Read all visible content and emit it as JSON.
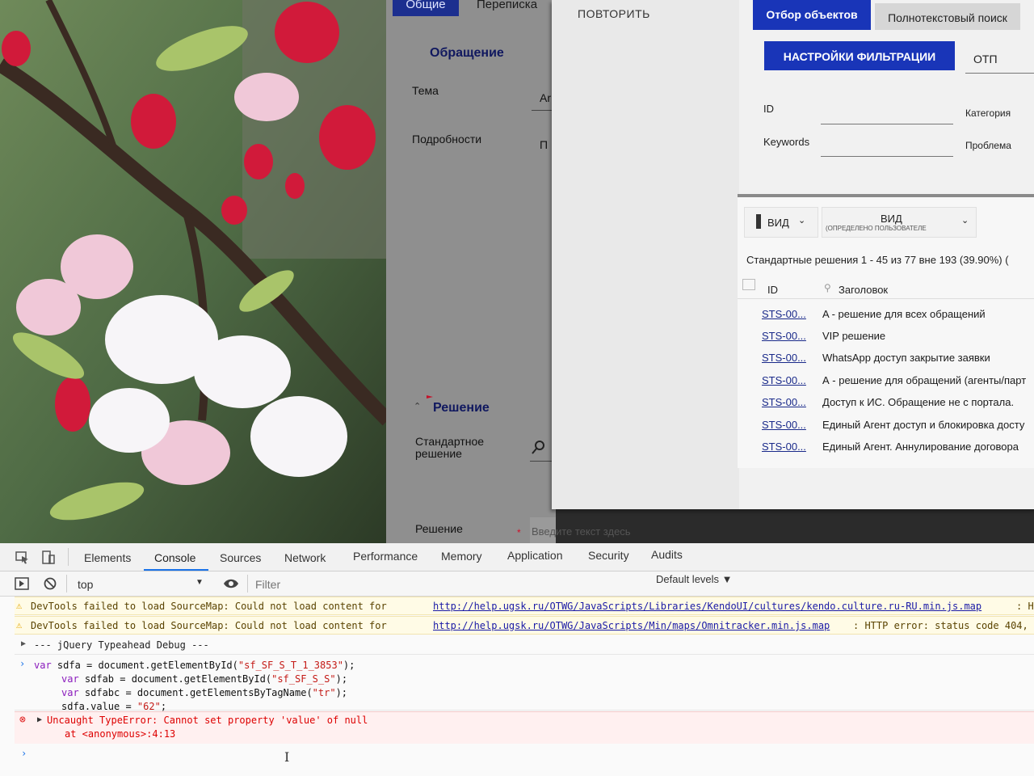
{
  "form": {
    "tab_general": "Общие",
    "tab_correspondence": "Переписка",
    "section_request": "Обращение",
    "label_subject": "Тема",
    "value_subject_cut": "Ar",
    "label_details": "Подробности",
    "value_details_cut": "П",
    "section_solution": "Решение",
    "label_standard_solution": "Стандартное решение",
    "label_solution": "Решение",
    "solution_placeholder": "Введите текст здесь"
  },
  "modal": {
    "repeat_label": "ПОВТОРИТЬ",
    "tab_filter": "Отбор объектов",
    "tab_fulltext": "Полнотекстовый поиск",
    "filter_settings_button": "НАСТРОЙКИ ФИЛЬТРАЦИИ",
    "otp_label": "ОТП",
    "label_id": "ID",
    "label_keywords": "Keywords",
    "label_category": "Категория",
    "label_problem": "Проблема",
    "view_label": "ВИД",
    "view2_label": "ВИД",
    "view2_sub": "(ОПРЕДЕЛЕНО ПОЛЬЗОВАТЕЛЕ",
    "results_summary": "Стандартные решения 1 - 45 из 77 вне 193 (39.90%) (",
    "col_id": "ID",
    "col_title": "Заголовок",
    "rows": [
      {
        "id": "STS-00...",
        "title": "A - решение для всех обращений"
      },
      {
        "id": "STS-00...",
        "title": "VIP решение"
      },
      {
        "id": "STS-00...",
        "title": "WhatsApp доступ закрытие заявки"
      },
      {
        "id": "STS-00...",
        "title": "А - решение для обращений (агенты/парт"
      },
      {
        "id": "STS-00...",
        "title": "Доступ к ИС. Обращение не с портала."
      },
      {
        "id": "STS-00...",
        "title": "Единый Агент доступ и блокировка досту"
      },
      {
        "id": "STS-00...",
        "title": "Единый Агент. Аннулирование договора"
      }
    ]
  },
  "devtools": {
    "tabs": [
      "Elements",
      "Console",
      "Sources",
      "Network",
      "Performance",
      "Memory",
      "Application",
      "Security",
      "Audits"
    ],
    "context": "top",
    "filter_placeholder": "Filter",
    "levels": "Default levels ▼",
    "warn1_prefix": "DevTools failed to load SourceMap: Could not load content for",
    "warn1_url": "http://help.ugsk.ru/OTWG/JavaScripts/Libraries/KendoUI/cultures/kendo.culture.ru-RU.min.js.map",
    "warn1_suffix": ": H",
    "warn2_prefix": "DevTools failed to load SourceMap: Could not load content for",
    "warn2_url": "http://help.ugsk.ru/OTWG/JavaScripts/Min/maps/Omnitracker.min.js.map",
    "warn2_suffix": ": HTTP error: status code 404,",
    "group_label": "--- jQuery Typeahead Debug ---",
    "code": [
      {
        "kw": "var",
        "rest": " sdfa = document.getElementById(",
        "str": "\"sf_SF_S_T_1_3853\"",
        "end": ");"
      },
      {
        "kw": "var",
        "rest": " sdfab = document.getElementById(",
        "str": "\"sf_SF_S_S\"",
        "end": ");"
      },
      {
        "kw": "var",
        "rest": " sdfabc = document.getElementsByTagName(",
        "str": "\"tr\"",
        "end": ");"
      },
      {
        "kw": "",
        "rest": "sdfa.value = ",
        "str": "\"62\"",
        "end": ";"
      }
    ],
    "error_text": "Uncaught TypeError: Cannot set property 'value' of null",
    "error_at": "at <anonymous>:4:13"
  }
}
